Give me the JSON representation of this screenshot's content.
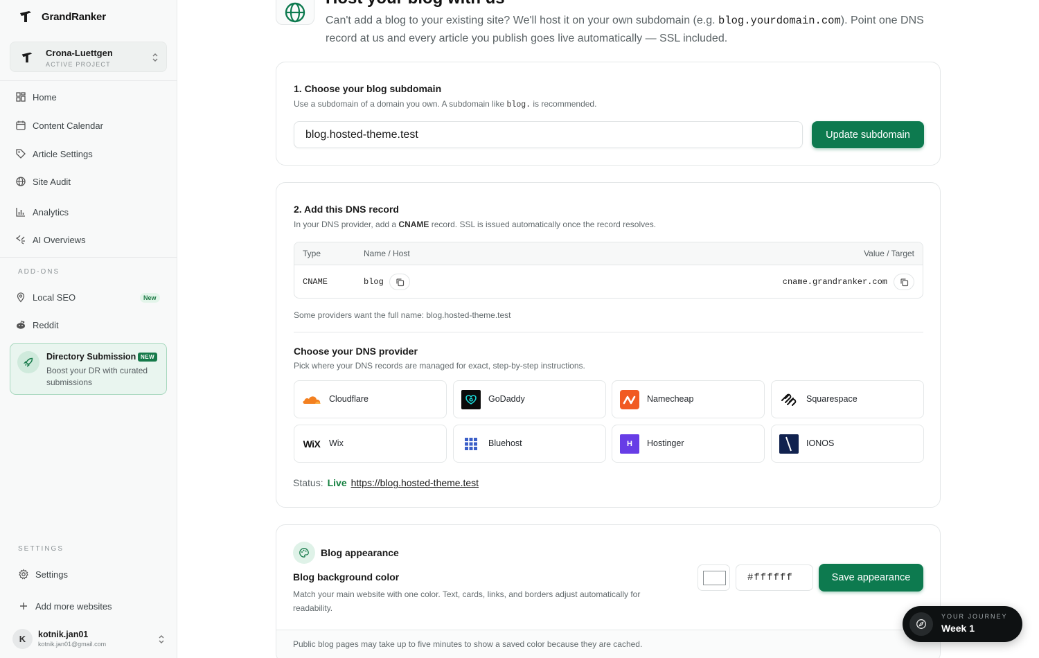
{
  "sidebar": {
    "brand": "GrandRanker",
    "project": {
      "name": "Crona-Luettgen",
      "subtitle": "ACTIVE PROJECT"
    },
    "nav": [
      {
        "label": "Home",
        "icon": "grid-icon"
      },
      {
        "label": "Content Calendar",
        "icon": "calendar-icon"
      },
      {
        "label": "Article Settings",
        "icon": "tag-icon"
      },
      {
        "label": "Site Audit",
        "icon": "globe-icon"
      },
      {
        "label": "Analytics",
        "icon": "bar-chart-icon"
      },
      {
        "label": "AI Overviews",
        "icon": "sparkle-icon"
      }
    ],
    "addons_label": "ADD-ONS",
    "addons": [
      {
        "label": "Local SEO",
        "icon": "map-pin-icon",
        "badge": "New"
      },
      {
        "label": "Reddit",
        "icon": "reddit-icon"
      }
    ],
    "promo": {
      "title": "Directory Submission",
      "badge": "NEW",
      "description": "Boost your DR with curated submissions"
    },
    "settings_label": "SETTINGS",
    "settings_items": [
      {
        "label": "Settings",
        "icon": "gear-icon"
      },
      {
        "label": "Add more websites",
        "icon": "plus-icon"
      }
    ],
    "user": {
      "initial": "K",
      "name": "kotnik.jan01",
      "email": "kotnik.jan01@gmail.com"
    }
  },
  "hero": {
    "title": "Host your blog with us",
    "desc_before": "Can't add a blog to your existing site? We'll host it on your own subdomain (e.g. ",
    "desc_code": "blog.yourdomain.com",
    "desc_after": "). Point one DNS record at us and every article you publish goes live automatically — SSL included."
  },
  "step1": {
    "title": "1. Choose your blog subdomain",
    "sub_before": "Use a subdomain of a domain you own. A subdomain like ",
    "sub_code": "blog.",
    "sub_after": " is recommended.",
    "input_value": "blog.hosted-theme.test",
    "button": "Update subdomain"
  },
  "step2": {
    "title": "2. Add this DNS record",
    "sub_before": "In your DNS provider, add a ",
    "sub_bold": "CNAME",
    "sub_after": " record. SSL is issued automatically once the record resolves.",
    "table": {
      "headers": {
        "type": "Type",
        "name": "Name / Host",
        "value": "Value / Target"
      },
      "row": {
        "type": "CNAME",
        "name": "blog",
        "value": "cname.grandranker.com"
      }
    },
    "full_name_note": "Some providers want the full name: blog.hosted-theme.test",
    "provider_title": "Choose your DNS provider",
    "provider_sub": "Pick where your DNS records are managed for exact, step-by-step instructions.",
    "providers": [
      {
        "label": "Cloudflare",
        "icon": "cloudflare-icon"
      },
      {
        "label": "GoDaddy",
        "icon": "godaddy-icon"
      },
      {
        "label": "Namecheap",
        "icon": "namecheap-icon"
      },
      {
        "label": "Squarespace",
        "icon": "squarespace-icon"
      },
      {
        "label": "Wix",
        "icon": "wix-icon",
        "logo_text": "WiX"
      },
      {
        "label": "Bluehost",
        "icon": "bluehost-icon"
      },
      {
        "label": "Hostinger",
        "icon": "hostinger-icon",
        "logo_text": "H"
      },
      {
        "label": "IONOS",
        "icon": "ionos-icon"
      }
    ],
    "status_label": "Status:",
    "status_value": "Live",
    "status_link": "https://blog.hosted-theme.test"
  },
  "appearance": {
    "title": "Blog appearance",
    "field_label": "Blog background color",
    "field_desc": "Match your main website with one color. Text, cards, links, and borders adjust automatically for readability.",
    "hex_value": "#ffffff",
    "button": "Save appearance",
    "footnote": "Public blog pages may take up to five minutes to show a saved color because they are cached."
  },
  "journey": {
    "label": "YOUR JOURNEY",
    "value": "Week 1"
  },
  "colors": {
    "accent": "#0d7a4f",
    "live": "#14803f",
    "cloudflare": "#f38020",
    "namecheap": "#f15a22",
    "hostinger": "#673de6",
    "ionos": "#11224f"
  }
}
